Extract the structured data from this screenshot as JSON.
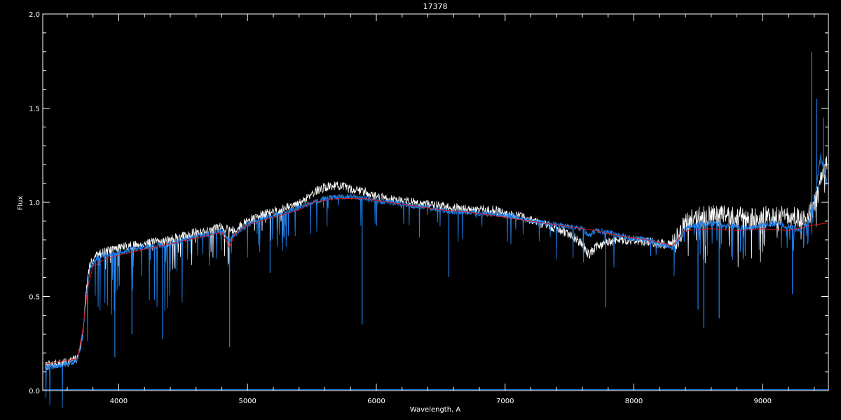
{
  "chart_data": {
    "type": "line",
    "title": "17378",
    "xlabel": "Wavelength, A",
    "ylabel": "Flux",
    "xlim": [
      3410,
      9510
    ],
    "ylim": [
      0.0,
      2.0
    ],
    "xticks": [
      4000,
      5000,
      6000,
      7000,
      8000,
      9000
    ],
    "yticks": [
      0.0,
      0.5,
      1.0,
      1.5,
      2.0
    ],
    "ytick_labels": [
      "0.0",
      "0.5",
      "1.0",
      "1.5",
      "2.0"
    ],
    "grid": false,
    "legend": "none",
    "colors": {
      "background": "#000000",
      "axes": "#ffffff",
      "observed": "#ffffff",
      "model": "#1e7fe8",
      "continuum": "#d81818"
    },
    "series": [
      {
        "role": "observed",
        "color": "#ffffff",
        "x": [
          3430,
          3500,
          3600,
          3680,
          3720,
          3750,
          3780,
          3830,
          3900,
          4000,
          4100,
          4200,
          4300,
          4400,
          4500,
          4600,
          4700,
          4800,
          4860,
          4900,
          5000,
          5100,
          5200,
          5300,
          5400,
          5500,
          5600,
          5700,
          5800,
          5900,
          6000,
          6100,
          6200,
          6300,
          6400,
          6500,
          6600,
          6700,
          6800,
          6900,
          7000,
          7100,
          7200,
          7300,
          7400,
          7500,
          7600,
          7650,
          7700,
          7800,
          7900,
          8000,
          8100,
          8200,
          8300,
          8350,
          8400,
          8500,
          8600,
          8700,
          8800,
          8900,
          9000,
          9100,
          9200,
          9300,
          9350,
          9400,
          9450,
          9500
        ],
        "y": [
          0.13,
          0.14,
          0.15,
          0.17,
          0.3,
          0.55,
          0.68,
          0.72,
          0.74,
          0.76,
          0.77,
          0.78,
          0.79,
          0.8,
          0.82,
          0.84,
          0.85,
          0.87,
          0.86,
          0.85,
          0.9,
          0.93,
          0.95,
          0.97,
          0.99,
          1.05,
          1.08,
          1.09,
          1.07,
          1.06,
          1.03,
          1.02,
          1.01,
          1.0,
          0.99,
          0.98,
          0.97,
          0.96,
          0.96,
          0.96,
          0.94,
          0.93,
          0.91,
          0.88,
          0.86,
          0.83,
          0.78,
          0.72,
          0.76,
          0.79,
          0.8,
          0.8,
          0.79,
          0.78,
          0.77,
          0.82,
          0.9,
          0.92,
          0.93,
          0.93,
          0.92,
          0.91,
          0.92,
          0.93,
          0.92,
          0.91,
          0.93,
          0.98,
          1.1,
          1.2
        ]
      },
      {
        "role": "model",
        "color": "#1e7fe8",
        "x": [
          3430,
          3500,
          3600,
          3680,
          3720,
          3750,
          3780,
          3830,
          3900,
          4000,
          4100,
          4200,
          4300,
          4400,
          4500,
          4600,
          4700,
          4800,
          4860,
          4900,
          5000,
          5100,
          5200,
          5300,
          5400,
          5500,
          5600,
          5700,
          5800,
          5900,
          6000,
          6100,
          6200,
          6300,
          6400,
          6500,
          6600,
          6700,
          6800,
          6900,
          7000,
          7100,
          7200,
          7300,
          7400,
          7500,
          7600,
          7650,
          7700,
          7800,
          7900,
          8000,
          8100,
          8200,
          8300,
          8350,
          8400,
          8500,
          8600,
          8700,
          8800,
          8900,
          9000,
          9100,
          9200,
          9300,
          9350,
          9400,
          9450,
          9500
        ],
        "y": [
          0.12,
          0.13,
          0.14,
          0.16,
          0.28,
          0.52,
          0.66,
          0.7,
          0.72,
          0.73,
          0.75,
          0.76,
          0.77,
          0.78,
          0.8,
          0.82,
          0.83,
          0.85,
          0.8,
          0.83,
          0.88,
          0.91,
          0.93,
          0.95,
          0.97,
          1.0,
          1.02,
          1.03,
          1.03,
          1.02,
          1.01,
          1.0,
          0.99,
          0.98,
          0.97,
          0.96,
          0.95,
          0.95,
          0.94,
          0.94,
          0.93,
          0.92,
          0.9,
          0.89,
          0.88,
          0.87,
          0.86,
          0.82,
          0.85,
          0.84,
          0.82,
          0.81,
          0.8,
          0.78,
          0.76,
          0.8,
          0.86,
          0.88,
          0.89,
          0.88,
          0.87,
          0.86,
          0.88,
          0.89,
          0.87,
          0.85,
          0.9,
          1.0,
          1.25,
          1.1
        ]
      },
      {
        "role": "continuum",
        "color": "#d81818",
        "x": [
          3430,
          3500,
          3600,
          3680,
          3720,
          3760,
          3800,
          3900,
          4000,
          4200,
          4400,
          4600,
          4800,
          4860,
          4900,
          5000,
          5200,
          5400,
          5500,
          5700,
          5900,
          6100,
          6300,
          6500,
          6700,
          6900,
          7100,
          7300,
          7500,
          7700,
          7900,
          8100,
          8300,
          8400,
          8600,
          8800,
          9000,
          9200,
          9400,
          9500
        ],
        "y": [
          0.14,
          0.15,
          0.16,
          0.17,
          0.32,
          0.55,
          0.66,
          0.7,
          0.72,
          0.75,
          0.78,
          0.81,
          0.84,
          0.76,
          0.83,
          0.88,
          0.92,
          0.96,
          1.0,
          1.02,
          1.02,
          1.0,
          0.98,
          0.96,
          0.95,
          0.93,
          0.91,
          0.89,
          0.87,
          0.85,
          0.82,
          0.8,
          0.77,
          0.85,
          0.86,
          0.85,
          0.86,
          0.85,
          0.88,
          0.89
        ]
      }
    ],
    "absorption_lines": [
      {
        "x": 3970,
        "depth": 0.55
      },
      {
        "x": 4102,
        "depth": 0.45
      },
      {
        "x": 4340,
        "depth": 0.5
      },
      {
        "x": 4861,
        "depth": 0.57
      },
      {
        "x": 5175,
        "depth": 0.3
      },
      {
        "x": 5270,
        "depth": 0.2
      },
      {
        "x": 5890,
        "depth": 0.67
      },
      {
        "x": 6563,
        "depth": 0.35
      },
      {
        "x": 7606,
        "depth": 0.12
      },
      {
        "x": 7780,
        "depth": 0.4
      },
      {
        "x": 8498,
        "depth": 0.45
      },
      {
        "x": 8542,
        "depth": 0.55
      },
      {
        "x": 8662,
        "depth": 0.5
      },
      {
        "x": 9230,
        "depth": 0.35
      }
    ],
    "emission_spikes": [
      {
        "x": 9380,
        "peak": 1.8
      },
      {
        "x": 9420,
        "peak": 1.55
      },
      {
        "x": 9470,
        "peak": 1.45
      }
    ]
  }
}
